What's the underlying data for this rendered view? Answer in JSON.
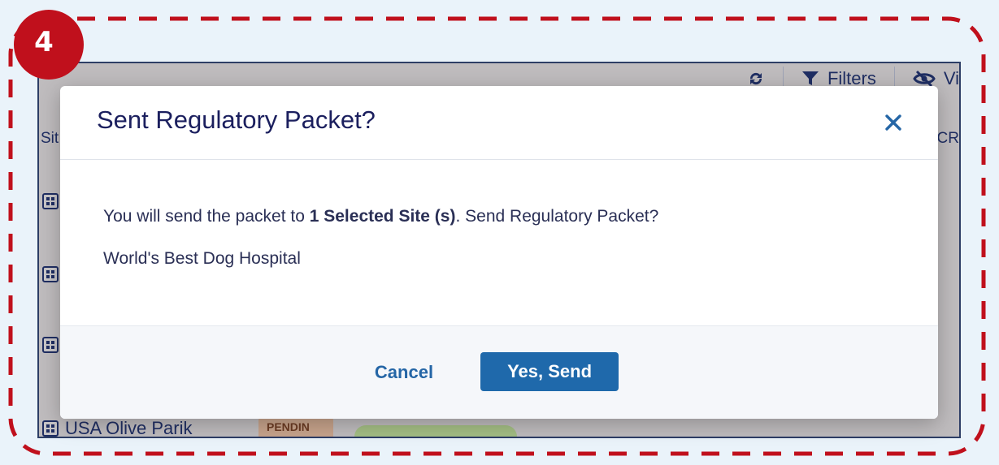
{
  "step_badge": "4",
  "toolbar": {
    "refresh_icon": "refresh-icon",
    "filters_label": "Filters",
    "view_label": "Vi"
  },
  "background": {
    "column_site": "Sit",
    "column_cr": "CR",
    "last_row_site": "USA Olive Parik",
    "last_row_status": "PENDIN"
  },
  "modal": {
    "title": "Sent Regulatory Packet?",
    "message_prefix": "You will send the packet to ",
    "message_bold": "1 Selected Site (s)",
    "message_suffix": ". Send Regulatory Packet?",
    "site_name": "World's Best Dog Hospital",
    "cancel_label": "Cancel",
    "confirm_label": "Yes, Send"
  },
  "colors": {
    "callout": "#c0101c",
    "primary": "#1f69ab",
    "title": "#1b1f5e"
  }
}
